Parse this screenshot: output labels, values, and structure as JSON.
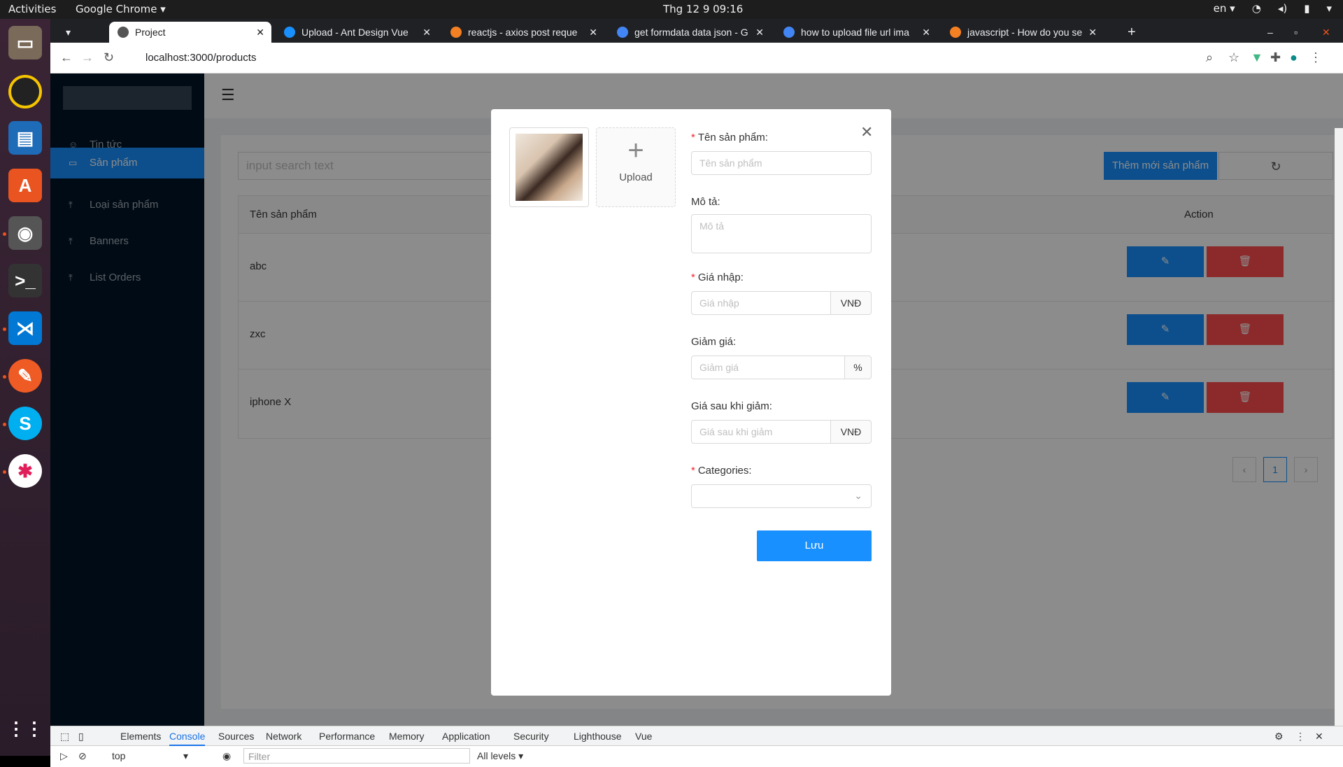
{
  "topbar": {
    "activities": "Activities",
    "app": "Google Chrome ▾",
    "clock": "Thg 12 9  09:16",
    "lang": "en ▾"
  },
  "tabs": [
    {
      "label": "Project"
    },
    {
      "label": "Upload - Ant Design Vue"
    },
    {
      "label": "reactjs - axios post reque"
    },
    {
      "label": "get formdata data json - G"
    },
    {
      "label": "how to upload file url ima"
    },
    {
      "label": "javascript - How do you se"
    }
  ],
  "address": {
    "url": "localhost:3000/products"
  },
  "sidebar": {
    "items": [
      {
        "label": "Tin tức"
      },
      {
        "label": "Sản phẩm"
      },
      {
        "label": "Loại sản phẩm"
      },
      {
        "label": "Banners"
      },
      {
        "label": "List Orders"
      }
    ]
  },
  "toolbar": {
    "search_placeholder": "input search text",
    "add_label": "Thêm mới sản phẩm"
  },
  "table": {
    "col_name": "Tên sản phẩm",
    "col_action": "Action",
    "rows": [
      {
        "name": "abc"
      },
      {
        "name": "zxc"
      },
      {
        "name": "iphone X"
      }
    ]
  },
  "pagination": {
    "current": "1"
  },
  "modal": {
    "upload_label": "Upload",
    "name_label": "Tên sản phẩm",
    "name_placeholder": "Tên sản phẩm",
    "desc_label": "Mô tả",
    "desc_placeholder": "Mô tả",
    "price_label": "Giá nhập",
    "price_placeholder": "Giá nhập",
    "price_unit": "VNĐ",
    "discount_label": "Giảm giá",
    "discount_placeholder": "Giảm giá",
    "discount_unit": "%",
    "final_label": "Giá sau khi giảm",
    "final_placeholder": "Giá sau khi giảm",
    "final_unit": "VNĐ",
    "cat_label": "Categories",
    "save_label": "Lưu"
  },
  "devtools": {
    "tabs": [
      "Elements",
      "Console",
      "Sources",
      "Network",
      "Performance",
      "Memory",
      "Application",
      "Security",
      "Lighthouse",
      "Vue"
    ],
    "context": "top",
    "filter_placeholder": "Filter",
    "levels": "All levels ▾"
  },
  "colors": {
    "primary": "#1890ff",
    "danger": "#ff4d4f",
    "sider": "#001529"
  }
}
